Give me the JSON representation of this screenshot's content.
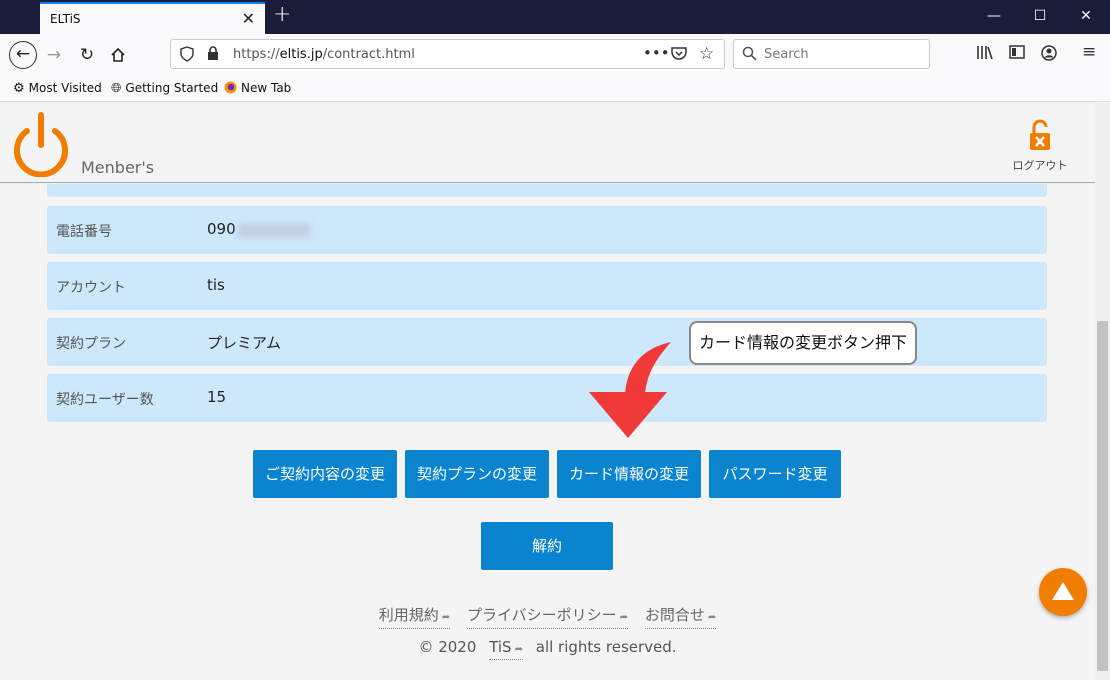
{
  "browser": {
    "tab_title": "ELTiS",
    "url_scheme": "https://",
    "url_host": "eltis.jp",
    "url_path": "/contract.html",
    "search_placeholder": "Search",
    "bookmarks": [
      "Most Visited",
      "Getting Started",
      "New Tab"
    ]
  },
  "header": {
    "brand": "Menber's",
    "logout_label": "ログアウト",
    "accent_color": "#f07d00"
  },
  "contract_rows": [
    {
      "label": "電話番号",
      "value": "090"
    },
    {
      "label": "アカウント",
      "value": "tis"
    },
    {
      "label": "契約プラン",
      "value": "プレミアム"
    },
    {
      "label": "契約ユーザー数",
      "value": "15"
    }
  ],
  "buttons": {
    "change_contract": "ご契約内容の変更",
    "change_plan": "契約プランの変更",
    "change_card": "カード情報の変更",
    "change_password": "パスワード変更",
    "cancel": "解約"
  },
  "annotation": {
    "callout": "カード情報の変更ボタン押下",
    "arrow_color": "#f03a3a"
  },
  "footer": {
    "links": [
      "利用規約",
      "プライバシーポリシー",
      "お問合せ"
    ],
    "copyright_prefix": "© 2020",
    "company": "TiS",
    "copyright_suffix": "all rights reserved."
  }
}
